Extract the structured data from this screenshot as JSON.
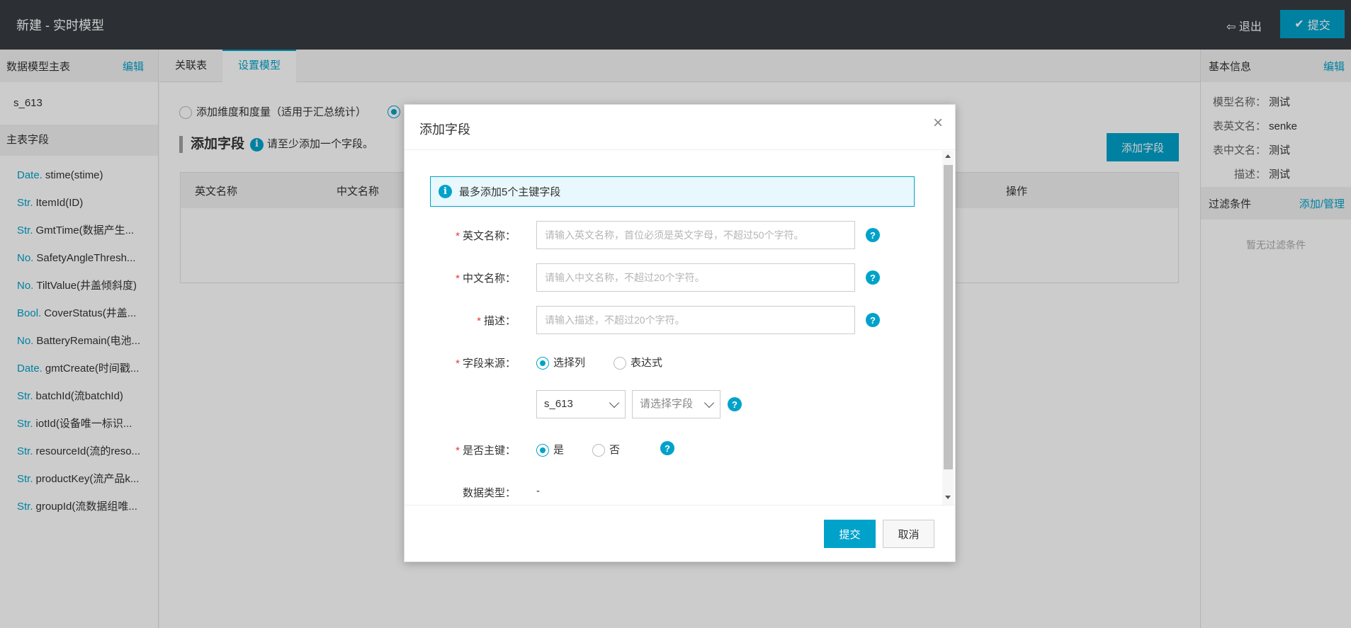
{
  "topbar": {
    "title": "新建 - 实时模型",
    "exit_label": "退出",
    "submit_label": "提交"
  },
  "left_panel": {
    "header": "数据模型主表",
    "edit_label": "编辑",
    "table_name": "s_613",
    "fields_header": "主表字段",
    "fields": [
      {
        "type": "Date.",
        "name": "stime(stime)"
      },
      {
        "type": "Str.",
        "name": "ItemId(ID)"
      },
      {
        "type": "Str.",
        "name": "GmtTime(数据产生..."
      },
      {
        "type": "No.",
        "name": "SafetyAngleThresh..."
      },
      {
        "type": "No.",
        "name": "TiltValue(井盖倾斜度)"
      },
      {
        "type": "Bool.",
        "name": "CoverStatus(井盖..."
      },
      {
        "type": "No.",
        "name": "BatteryRemain(电池..."
      },
      {
        "type": "Date.",
        "name": "gmtCreate(时间戳..."
      },
      {
        "type": "Str.",
        "name": "batchId(流batchId)"
      },
      {
        "type": "Str.",
        "name": "iotId(设备唯一标识..."
      },
      {
        "type": "Str.",
        "name": "resourceId(流的reso..."
      },
      {
        "type": "Str.",
        "name": "productKey(流产品k..."
      },
      {
        "type": "Str.",
        "name": "groupId(流数据组唯..."
      }
    ]
  },
  "center": {
    "tabs": [
      {
        "label": "关联表",
        "active": false
      },
      {
        "label": "设置模型",
        "active": true
      }
    ],
    "mode_option_1": "添加维度和度量（适用于汇总统计）",
    "section_title": "添加字段",
    "section_hint": "请至少添加一个字段。",
    "add_field_button": "添加字段",
    "table_headers": {
      "english_name": "英文名称",
      "chinese_name": "中文名称",
      "operation": "操作"
    }
  },
  "right_panel": {
    "basic_header": "基本信息",
    "edit_label": "编辑",
    "info": [
      {
        "key": "模型名称：",
        "value": "测试"
      },
      {
        "key": "表英文名：",
        "value": "senke"
      },
      {
        "key": "表中文名：",
        "value": "测试"
      },
      {
        "key": "描述：",
        "value": "测试"
      }
    ],
    "filter_header": "过滤条件",
    "filter_action": "添加/管理",
    "filter_empty": "暂无过滤条件"
  },
  "modal": {
    "title": "添加字段",
    "notice": "最多添加5个主键字段",
    "english_name_label": "英文名称：",
    "english_name_placeholder": "请输入英文名称，首位必须是英文字母，不超过50个字符。",
    "chinese_name_label": "中文名称：",
    "chinese_name_placeholder": "请输入中文名称，不超过20个字符。",
    "description_label": "描述：",
    "description_placeholder": "请输入描述，不超过20个字符。",
    "source_label": "字段来源：",
    "source_option_column": "选择列",
    "source_option_expression": "表达式",
    "table_select_value": "s_613",
    "field_select_placeholder": "请选择字段",
    "primary_key_label": "是否主键：",
    "primary_key_yes": "是",
    "primary_key_no": "否",
    "data_type_label": "数据类型：",
    "data_type_value": "-",
    "submit_label": "提交",
    "cancel_label": "取消"
  },
  "colors": {
    "accent": "#00a2ca",
    "topbar": "#373d41",
    "required": "#e4393c"
  }
}
